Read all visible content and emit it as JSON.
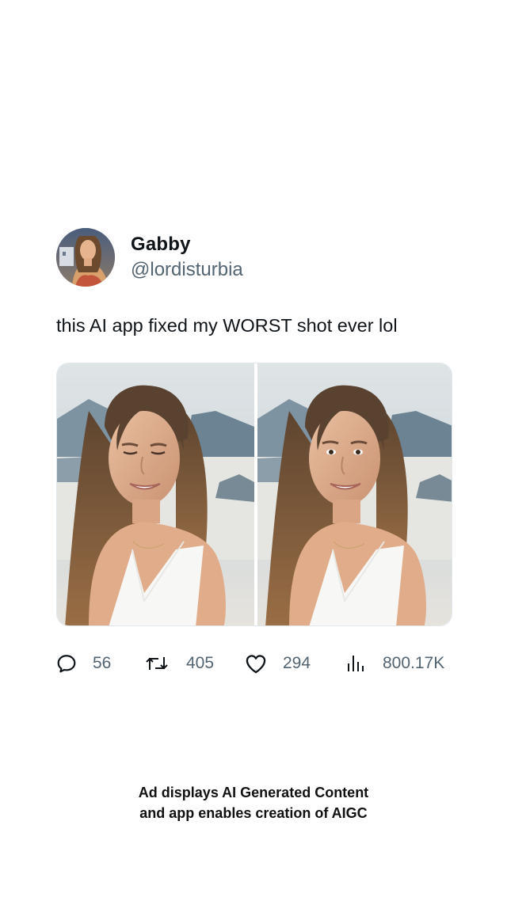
{
  "tweet": {
    "author": {
      "display_name": "Gabby",
      "handle": "@lordisturbia",
      "avatar_icon": "user-avatar"
    },
    "text": "this AI app fixed my WORST shot ever lol",
    "media": [
      {
        "description": "Before photo: woman with eyes closed, smiling, sea and islands behind"
      },
      {
        "description": "After photo: same woman with eyes open, smiling, sea and islands behind"
      }
    ],
    "stats": {
      "replies": "56",
      "retweets": "405",
      "likes": "294",
      "views": "800.17K"
    },
    "icons": {
      "reply": "reply-icon",
      "retweet": "retweet-icon",
      "like": "heart-icon",
      "views": "views-icon"
    }
  },
  "disclaimer": {
    "line1": "Ad displays AI Generated Content",
    "line2": "and app enables creation of AIGC"
  },
  "colors": {
    "text_primary": "#0f1419",
    "text_secondary": "#536471",
    "background": "#ffffff"
  }
}
